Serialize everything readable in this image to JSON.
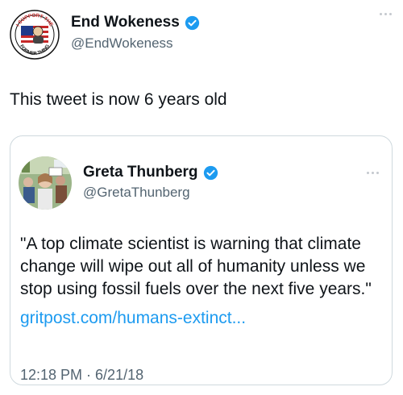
{
  "outer_tweet": {
    "display_name": "End Wokeness",
    "handle": "@EndWokeness",
    "text": "This tweet is now 6 years old",
    "avatar_text_top": "I SUPPORT THE",
    "avatar_text_bottom": "FORMER THING"
  },
  "quoted_tweet": {
    "display_name": "Greta Thunberg",
    "handle": "@GretaThunberg",
    "text": "\"A top climate scientist is warning that climate change will wipe out all of humanity unless we stop using fossil fuels over the next five years.\"",
    "link": "gritpost.com/humans-extinct...",
    "timestamp": "12:18 PM · 6/21/18"
  },
  "colors": {
    "verified_blue": "#1d9bf0",
    "link_blue": "#1d9bf0",
    "handle_gray": "#536471",
    "border": "#cfd9de"
  },
  "icons": {
    "verified": "verified-badge-icon",
    "more": "more-options-icon"
  }
}
